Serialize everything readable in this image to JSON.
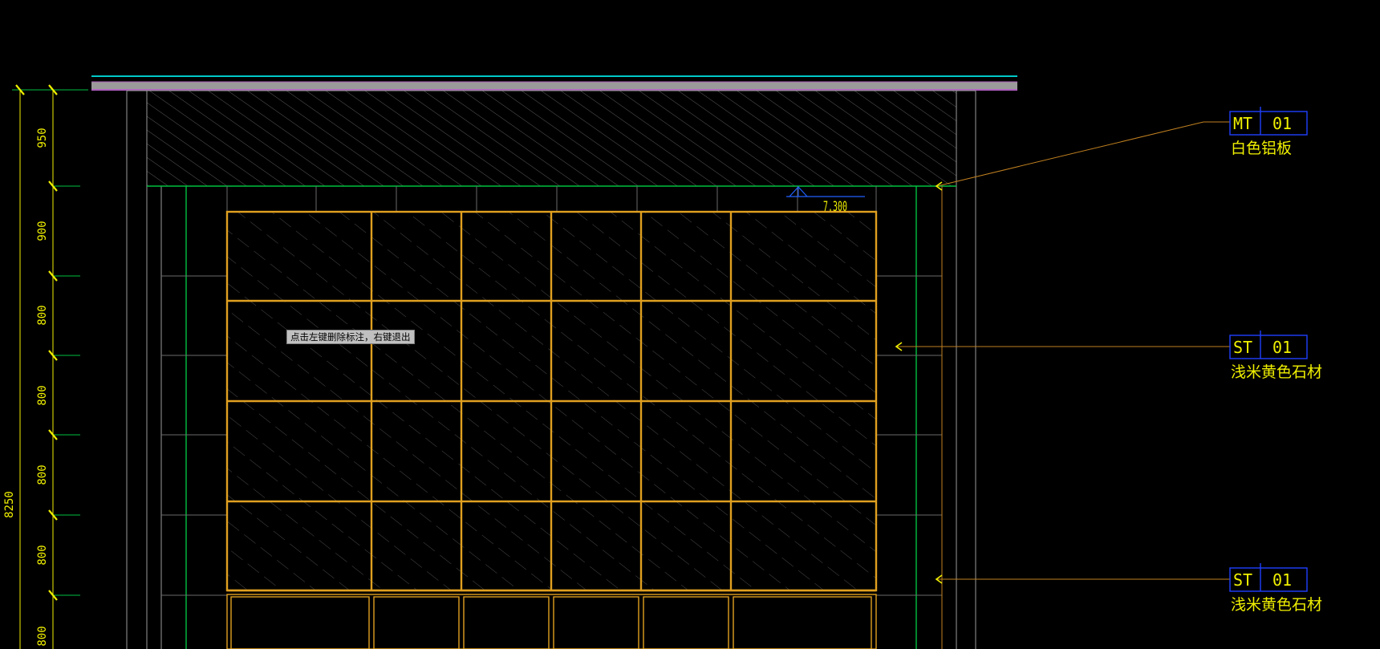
{
  "tooltip": {
    "text": "点击左键删除标注，右键退出"
  },
  "dimensions": {
    "segments": [
      "950",
      "900",
      "800",
      "800",
      "800",
      "800",
      "800"
    ],
    "total": "8250",
    "elevation_label": "7.300"
  },
  "material_tags": [
    {
      "code": "MT",
      "num": "01",
      "desc": "白色铝板"
    },
    {
      "code": "ST",
      "num": "01",
      "desc": "浅米黄色石材"
    },
    {
      "code": "ST",
      "num": "01",
      "desc": "浅米黄色石材"
    }
  ],
  "colors": {
    "background": "#000000",
    "dimension": "#f0f000",
    "frame": "#e0a020",
    "green_line": "#00c040",
    "cyan_line": "#00c8c8",
    "magenta_band": "#b060c0",
    "tag_box": "#2040ff",
    "leader": "#c08020"
  }
}
